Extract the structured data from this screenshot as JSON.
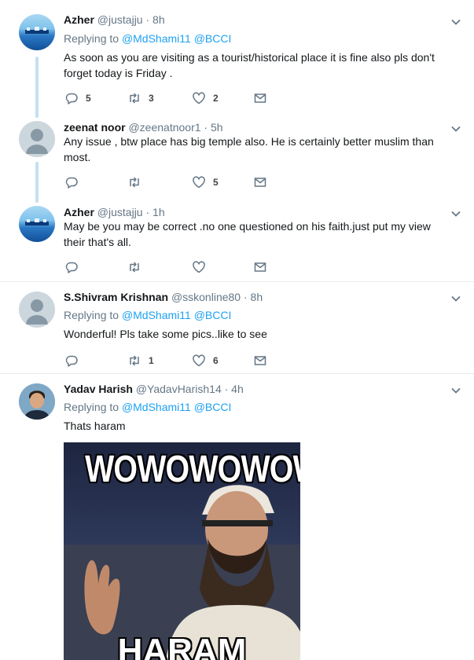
{
  "tweets": [
    {
      "name": "Azher",
      "handle": "@justajju",
      "time": "· 8h",
      "replying_prefix": "Replying to",
      "replying_to": [
        "@MdShami11",
        "@BCCI"
      ],
      "text": "As soon as you are visiting as a tourist/historical place it is fine also pls don't forget today is Friday .",
      "counts": {
        "reply": "5",
        "retweet": "3",
        "like": "2"
      }
    },
    {
      "name": "zeenat noor",
      "handle": "@zeenatnoor1",
      "time": "· 5h",
      "text": "Any issue , btw place has big temple also. He is certainly better muslim than most.",
      "counts": {
        "reply": "",
        "retweet": "",
        "like": "5"
      }
    },
    {
      "name": "Azher",
      "handle": "@justajju",
      "time": "· 1h",
      "text": "May be you may be correct .no one questioned on his faith.just put my view their that's all.",
      "counts": {
        "reply": "",
        "retweet": "",
        "like": ""
      }
    },
    {
      "name": "S.Shivram Krishnan",
      "handle": "@sskonline80",
      "time": "· 8h",
      "replying_prefix": "Replying to",
      "replying_to": [
        "@MdShami11",
        "@BCCI"
      ],
      "text": "Wonderful! Pls take some pics..like to see",
      "counts": {
        "reply": "",
        "retweet": "1",
        "like": "6"
      }
    },
    {
      "name": "Yadav Harish",
      "handle": "@YadavHarish14",
      "time": "· 4h",
      "replying_prefix": "Replying to",
      "replying_to": [
        "@MdShami11",
        "@BCCI"
      ],
      "text": "Thats haram",
      "meme": {
        "top_text": "WOWOWOWOW",
        "bottom_text": "HARAM"
      }
    }
  ],
  "icons": {
    "reply": "reply-icon",
    "retweet": "retweet-icon",
    "like": "heart-icon",
    "dm": "envelope-icon",
    "more": "chevron-down-icon"
  },
  "colors": {
    "link": "#1da1f2",
    "muted": "#657786",
    "thread_line": "#c4e0f2"
  }
}
